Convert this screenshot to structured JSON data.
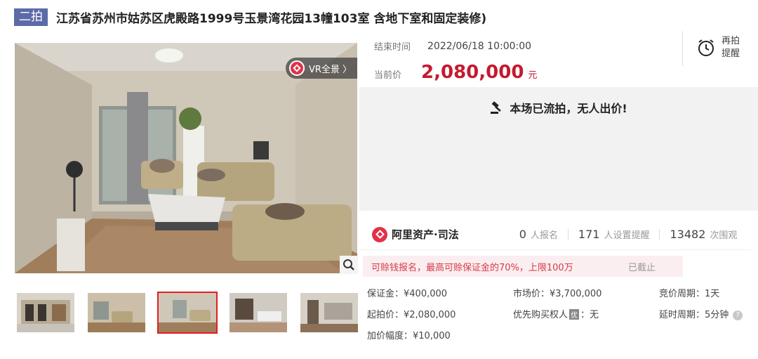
{
  "title": {
    "badge": "二拍",
    "text": "江苏省苏州市姑苏区虎殿路1999号玉景湾花园13幢103室 含地下室和固定装修)"
  },
  "photo": {
    "vr_label": "VR全景 〉",
    "thumbnail_count": 5,
    "active_thumbnail": 3
  },
  "auction": {
    "end_time_label": "结束时间",
    "end_time_value": "2022/06/18 10:00:00",
    "current_price_label": "当前价",
    "current_price_value": "2,080,000",
    "current_price_unit": "元",
    "remind_label_1": "再拍",
    "remind_label_2": "提醒",
    "status_text": "本场已流拍，无人出价!"
  },
  "platform": {
    "logo_text": "阿里资产·司法",
    "registrations_num": "0",
    "registrations_label": "人报名",
    "reminders_num": "171",
    "reminders_label": "人设置提醒",
    "views_num": "13482",
    "views_label": "次围观"
  },
  "notice": {
    "message": "可赊钱报名，最高可赊保证金的70%，上限100万",
    "status": "已截止"
  },
  "details": {
    "deposit": "保证金：¥400,000",
    "market_price": "市场价：¥3,700,000",
    "bid_period": "竞价周期：1天",
    "start_price": "起拍价：¥2,080,000",
    "priority_prefix": "优先购买权人",
    "priority_badge": "优",
    "priority_suffix": "：无",
    "extension_period": "延时周期：5分钟",
    "help_glyph": "?",
    "increment": "加价幅度：¥10,000"
  },
  "colors": {
    "badge_bg": "#5c6aa8",
    "price_red": "#c41a2e",
    "brand_red": "#e2314a",
    "notice_bg": "#fbeef0",
    "status_bg": "#f2f2f2"
  }
}
